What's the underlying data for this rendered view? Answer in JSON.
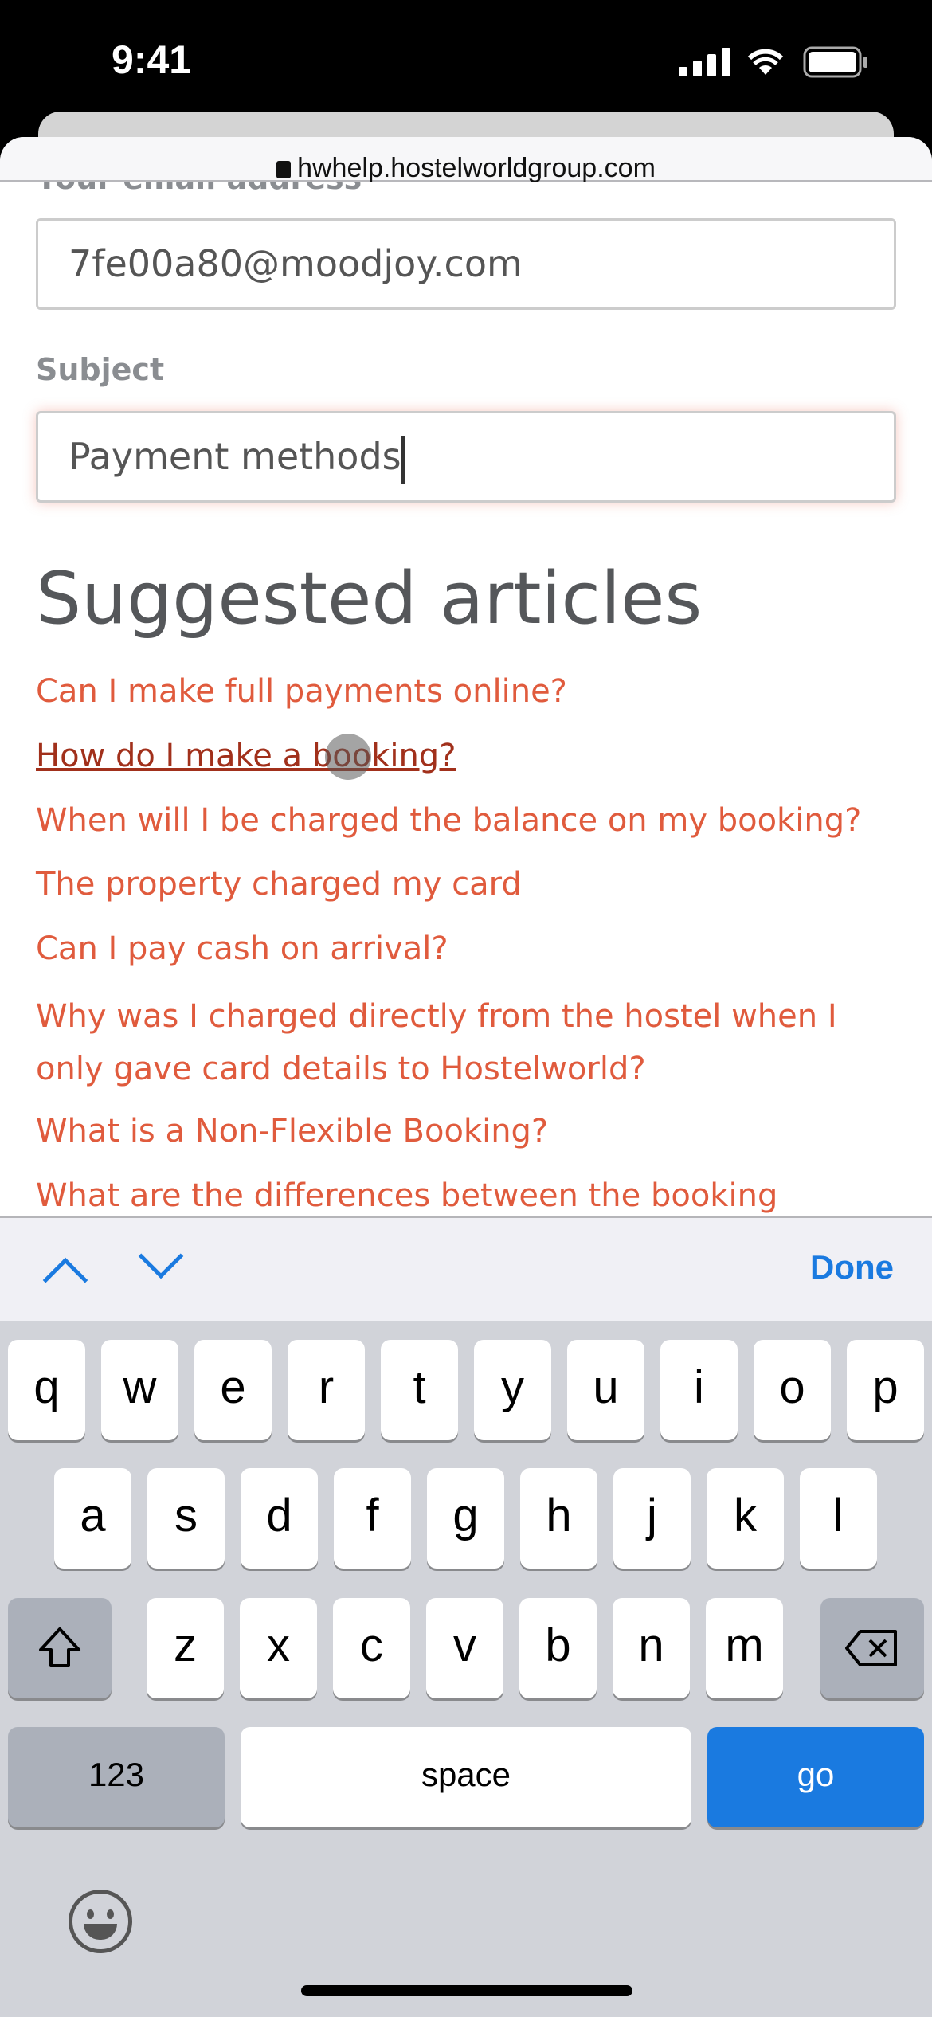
{
  "status": {
    "time": "9:41"
  },
  "browser": {
    "url": "hwhelp.hostelworldgroup.com"
  },
  "form": {
    "email_label": "Your email address",
    "email_value": "7fe00a80@moodjoy.com",
    "subject_label": "Subject",
    "subject_value": "Payment methods"
  },
  "suggested": {
    "heading": "Suggested articles",
    "link_color": "#e05b3d",
    "articles": [
      "Can I make full payments online?",
      "How do I make a booking?",
      "When will I be charged the balance on my booking?",
      "The property charged my card",
      "Can I pay cash on arrival?",
      "Why was I charged directly from the hostel when I only gave card details to Hostelworld?",
      "What is a Non-Flexible Booking?",
      "What are the differences between the booking"
    ]
  },
  "toolbar": {
    "prev_icon": "chevron-up",
    "next_icon": "chevron-down",
    "done": "Done"
  },
  "keyboard": {
    "row1": [
      "q",
      "w",
      "e",
      "r",
      "t",
      "y",
      "u",
      "i",
      "o",
      "p"
    ],
    "row2": [
      "a",
      "s",
      "d",
      "f",
      "g",
      "h",
      "j",
      "k",
      "l"
    ],
    "row3": [
      "z",
      "x",
      "c",
      "v",
      "b",
      "n",
      "m"
    ],
    "numbers": "123",
    "space": "space",
    "go": "go",
    "accent": "#1a7ae0"
  }
}
